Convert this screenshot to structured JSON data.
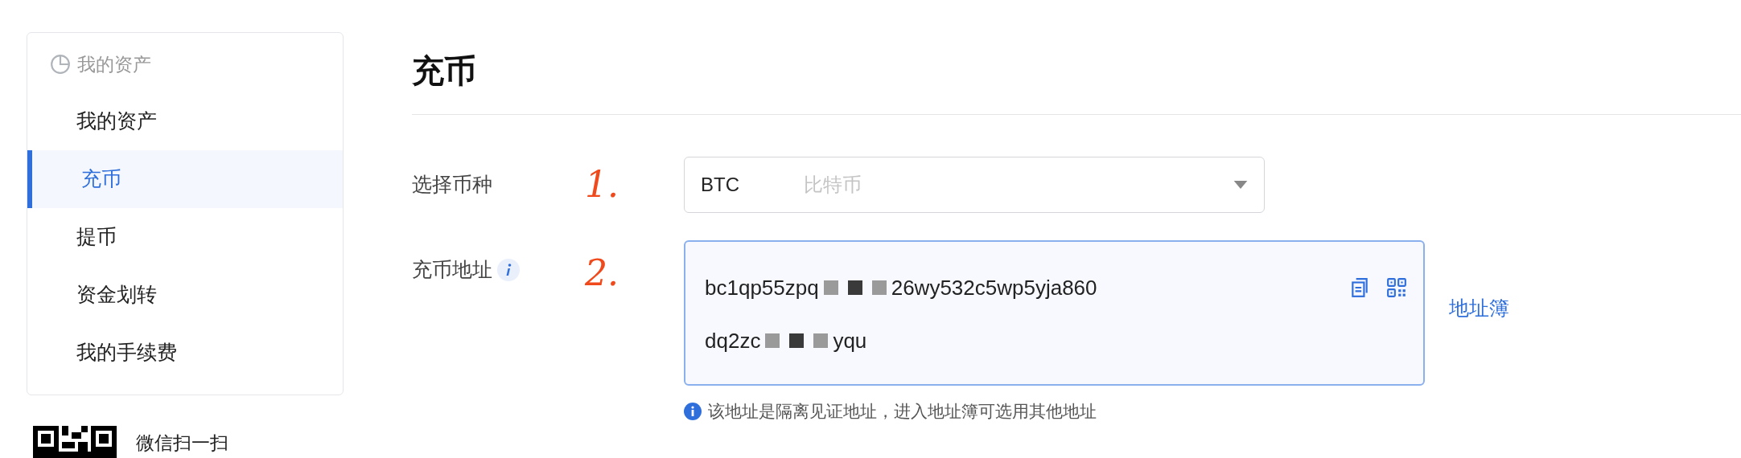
{
  "sidebar": {
    "group_title": "我的资产",
    "items": [
      {
        "label": "我的资产",
        "selected": false
      },
      {
        "label": "充币",
        "selected": true
      },
      {
        "label": "提币",
        "selected": false
      },
      {
        "label": "资金划转",
        "selected": false
      },
      {
        "label": "我的手续费",
        "selected": false
      }
    ],
    "qr_caption": "微信扫一扫"
  },
  "page_title": "充币",
  "currency": {
    "label": "选择币种",
    "symbol": "BTC",
    "name": "比特币",
    "annotation": "1."
  },
  "address": {
    "label": "充币地址",
    "annotation": "2.",
    "lines": [
      [
        {
          "kind": "text",
          "text": "bc1qp55zpq"
        },
        {
          "kind": "redacted"
        },
        {
          "kind": "redacted"
        },
        {
          "kind": "redacted"
        },
        {
          "kind": "text",
          "text": "26wy532c5wp5yja860"
        }
      ],
      [
        {
          "kind": "text",
          "text": "dq2zc"
        },
        {
          "kind": "redacted"
        },
        {
          "kind": "redacted"
        },
        {
          "kind": "redacted"
        },
        {
          "kind": "text",
          "text": "yqu"
        }
      ]
    ],
    "book_link": "地址簿",
    "hint": "该地址是隔离见证地址，进入地址簿可选用其他地址"
  }
}
